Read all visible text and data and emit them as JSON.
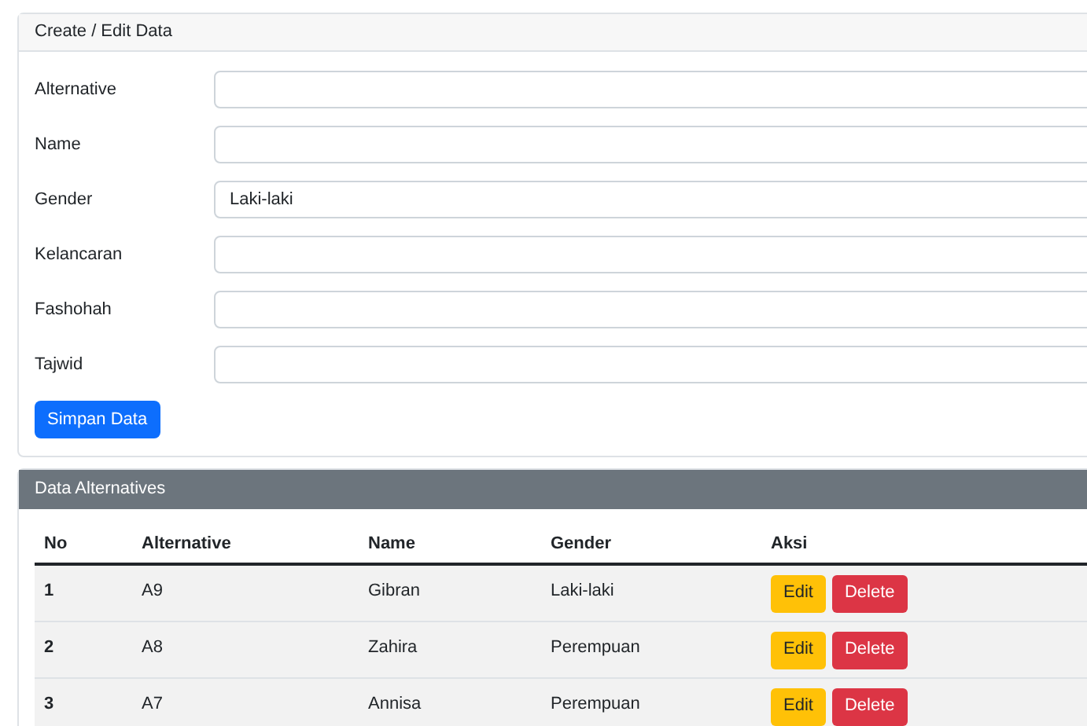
{
  "form_card": {
    "title": "Create / Edit Data",
    "fields": [
      {
        "label": "Alternative"
      },
      {
        "label": "Name"
      },
      {
        "label": "Gender",
        "value": "Laki-laki"
      },
      {
        "label": "Kelancaran"
      },
      {
        "label": "Fashohah"
      },
      {
        "label": "Tajwid"
      }
    ],
    "submit_button": "Simpan Data"
  },
  "table_card": {
    "title": "Data Alternatives",
    "columns": [
      "No",
      "Alternative",
      "Name",
      "Gender",
      "Aksi"
    ],
    "rows": [
      {
        "no": "1",
        "alternative": "A9",
        "name": "Gibran",
        "gender": "Laki-laki",
        "actions": [
          "Edit",
          "Delete"
        ]
      },
      {
        "no": "2",
        "alternative": "A8",
        "name": "Zahira",
        "gender": "Perempuan",
        "actions": [
          "Edit",
          "Delete"
        ]
      },
      {
        "no": "3",
        "alternative": "A7",
        "name": "Annisa",
        "gender": "Perempuan",
        "actions": [
          "Edit",
          "Delete"
        ]
      }
    ]
  }
}
